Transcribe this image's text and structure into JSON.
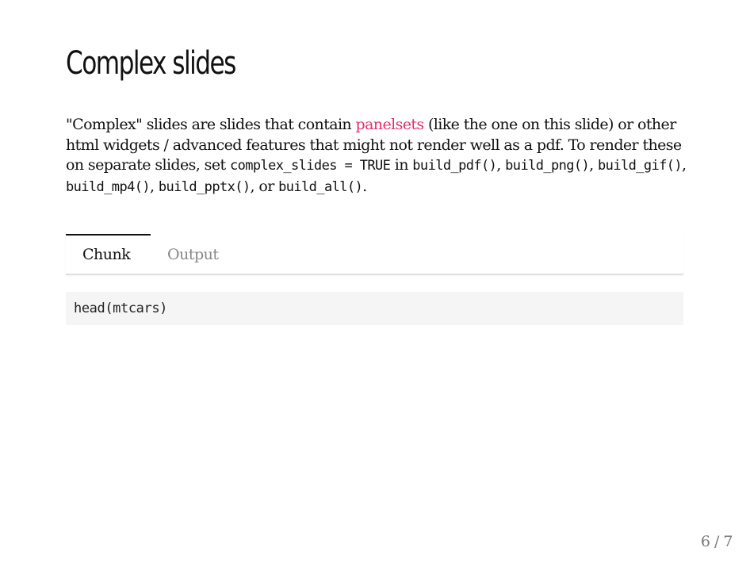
{
  "slide": {
    "title": "Complex slides",
    "paragraph": {
      "part1": "\"Complex\" slides are slides that contain ",
      "link_text": "panelsets",
      "part2": " (like the one on this slide) or other html widgets / advanced features that might not render well as a pdf. To render these on separate slides, set ",
      "code1": "complex_slides = TRUE",
      "part3": " in ",
      "code2": "build_pdf()",
      "sep1": ", ",
      "code3": "build_png()",
      "sep2": ", ",
      "code4": "build_gif()",
      "sep3": ", ",
      "code5": "build_mp4()",
      "sep4": ", ",
      "code6": "build_pptx()",
      "part4": ", or ",
      "code7": "build_all()",
      "part5": "."
    },
    "panelset": {
      "tabs": [
        {
          "label": "Chunk",
          "active": true
        },
        {
          "label": "Output",
          "active": false
        }
      ],
      "code": "head(mtcars)"
    },
    "page_number": "6 / 7"
  },
  "colors": {
    "link": "#e2306c",
    "text": "#111111",
    "muted": "#888888",
    "code_bg": "#f5f5f5"
  }
}
